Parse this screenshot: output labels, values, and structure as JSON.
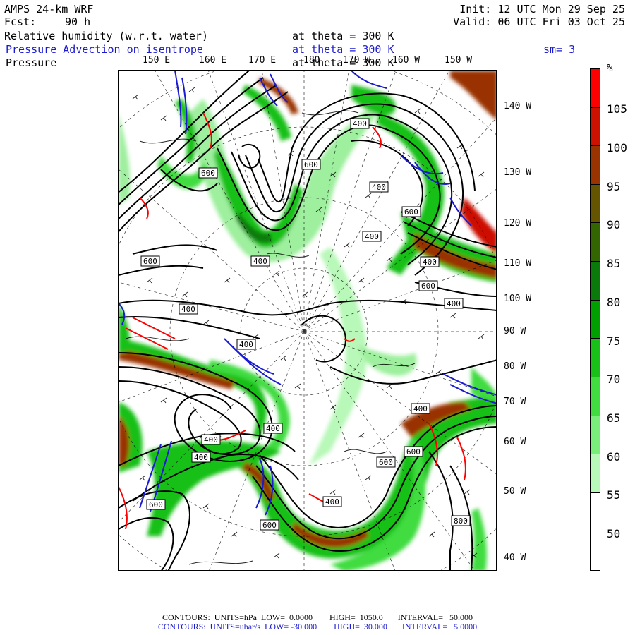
{
  "header": {
    "model": "AMPS 24-km WRF",
    "forecast_label": "Fcst:",
    "forecast_hours": "90 h",
    "init": "Init: 12 UTC Mon 29 Sep 25",
    "valid": "Valid: 06 UTC Fri 03 Oct 25"
  },
  "fields": [
    {
      "name": "Relative humidity (w.r.t. water)",
      "level": "at theta = 300 K",
      "color": "#000000"
    },
    {
      "name": "Pressure Advection on isentrope",
      "level": "at theta = 300 K",
      "color": "#1a1ad0"
    },
    {
      "name": "Pressure",
      "level": "at theta = 300 K",
      "color": "#000000"
    }
  ],
  "smoothing": "sm= 3",
  "longitude_labels_top": [
    "150 E",
    "160 E",
    "170 E",
    "180",
    "170 W",
    "160 W",
    "150 W"
  ],
  "longitude_labels_right": [
    "140 W",
    "130 W",
    "120 W",
    "110 W",
    "100 W",
    "90 W",
    "80 W",
    "70 W",
    "60 W",
    "50 W",
    "40 W"
  ],
  "contour_labels": [
    "600",
    "600",
    "400",
    "400",
    "400",
    "600",
    "400",
    "600",
    "400",
    "400",
    "400",
    "400",
    "600",
    "400",
    "400",
    "400",
    "400",
    "600",
    "400",
    "600",
    "600",
    "400",
    "600",
    "800"
  ],
  "colorbar": {
    "unit": "%",
    "labels": [
      "105",
      "100",
      "95",
      "90",
      "85",
      "80",
      "75",
      "70",
      "65",
      "60",
      "55",
      "50"
    ],
    "colors": [
      "#ff0000",
      "#cc1100",
      "#993300",
      "#665500",
      "#336600",
      "#0a7a0a",
      "#00a000",
      "#18c018",
      "#40dc40",
      "#7aee7a",
      "#b8f8b8",
      "#ffffff",
      "#ffffff"
    ]
  },
  "footer": {
    "line1": "CONTOURS:  UNITS=hPa  LOW=  0.0000        HIGH=  1050.0       INTERVAL=   50.000",
    "line2": "CONTOURS:  UNITS=ubar/s  LOW= -30.000        HIGH=  30.000       INTERVAL=   5.0000"
  }
}
